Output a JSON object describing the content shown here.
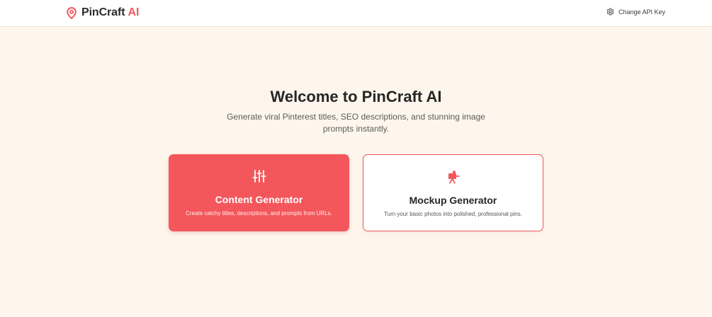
{
  "header": {
    "brand_name": "PinCraft",
    "brand_suffix": "AI",
    "api_button_label": "Change API Key"
  },
  "hero": {
    "title": "Welcome to PinCraft AI",
    "subtitle": "Generate viral Pinterest titles, SEO descriptions, and stunning image prompts instantly."
  },
  "cards": [
    {
      "title": "Content Generator",
      "description": "Create catchy titles, descriptions, and prompts from URLs.",
      "icon": "sliders-icon"
    },
    {
      "title": "Mockup Generator",
      "description": "Turn your basic photos into polished, professional pins.",
      "icon": "easel-icon"
    }
  ],
  "colors": {
    "accent": "#f3575c",
    "background": "#fef6ec",
    "header_bg": "#ffffff"
  }
}
